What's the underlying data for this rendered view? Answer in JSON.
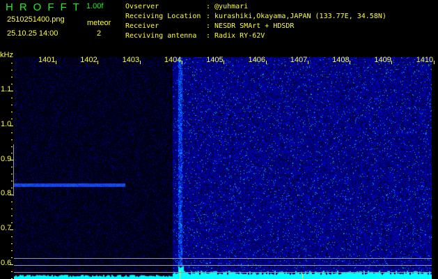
{
  "header": {
    "logo": "HROFFT",
    "version": "1.00f",
    "filename": "2510251400.png",
    "datetime": "25.10.25 14:00",
    "meteor_label": "meteor",
    "meteor_count": "2"
  },
  "info": [
    {
      "label": "Ovserver",
      "value": ": @yuhmari"
    },
    {
      "label": "Receiving Location",
      "value": ": kurashiki,Okayama,JAPAN (133.77E, 34.58N)"
    },
    {
      "label": "Receiver",
      "value": ": NESDR SMArt + HDSDR"
    },
    {
      "label": "Recviving antenna",
      "value": ": Radix RY-62V"
    }
  ],
  "axes": {
    "unit": "kHz",
    "x_ticks": [
      "1401",
      "1402",
      "1403",
      "1404",
      "1405",
      "1406",
      "1407",
      "1408",
      "1409",
      "1410"
    ],
    "y_ticks": [
      "1.1",
      "1.0",
      "0.9",
      "0.8",
      "0.7",
      "0.6"
    ]
  },
  "colors": {
    "text": "#ffff33",
    "logo": "#22ee22",
    "spectrum": "#00ffff",
    "signal": "#3355ff"
  }
}
